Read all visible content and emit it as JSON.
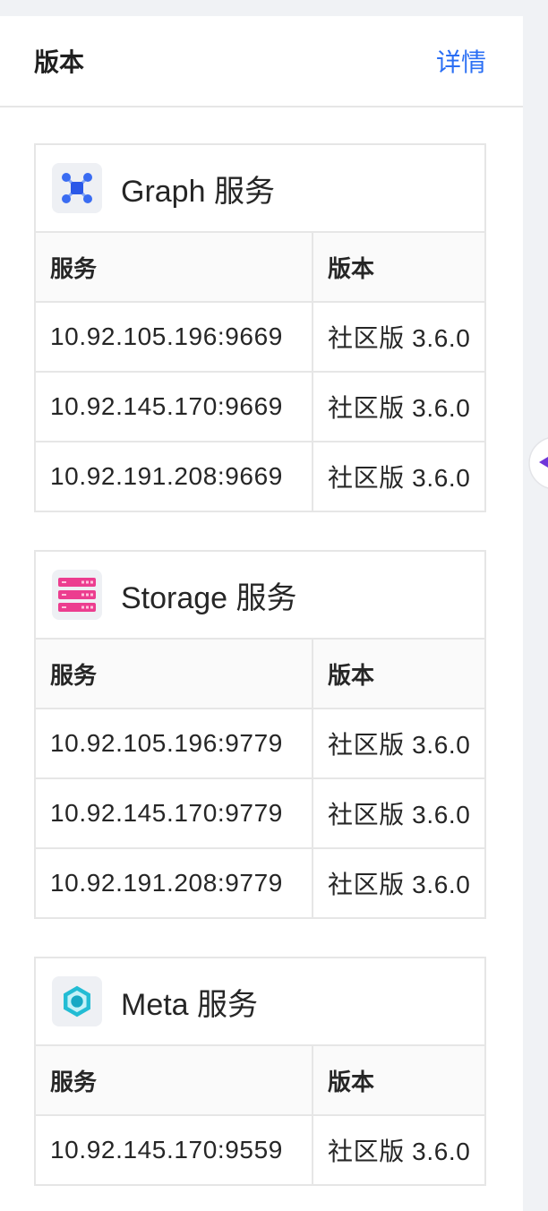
{
  "header": {
    "title": "版本",
    "detail_link": "详情"
  },
  "services": [
    {
      "title": "Graph 服务",
      "icon": "graph-network-icon",
      "columns": {
        "service": "服务",
        "version": "版本"
      },
      "rows": [
        {
          "address": "10.92.105.196:9669",
          "version": "社区版 3.6.0"
        },
        {
          "address": "10.92.145.170:9669",
          "version": "社区版 3.6.0"
        },
        {
          "address": "10.92.191.208:9669",
          "version": "社区版 3.6.0"
        }
      ]
    },
    {
      "title": "Storage 服务",
      "icon": "storage-server-icon",
      "columns": {
        "service": "服务",
        "version": "版本"
      },
      "rows": [
        {
          "address": "10.92.105.196:9779",
          "version": "社区版 3.6.0"
        },
        {
          "address": "10.92.145.170:9779",
          "version": "社区版 3.6.0"
        },
        {
          "address": "10.92.191.208:9779",
          "version": "社区版 3.6.0"
        }
      ]
    },
    {
      "title": "Meta 服务",
      "icon": "meta-hexagon-icon",
      "columns": {
        "service": "服务",
        "version": "版本"
      },
      "rows": [
        {
          "address": "10.92.145.170:9559",
          "version": "社区版 3.6.0"
        }
      ]
    }
  ],
  "collapse_button": {
    "icon": "caret-left-icon"
  },
  "colors": {
    "link": "#2b6ff4",
    "graph_icon": "#3a6cf2",
    "storage_icon": "#ec3d8f",
    "meta_icon": "#22bcd4",
    "collapse_arrow": "#6f36d9"
  }
}
